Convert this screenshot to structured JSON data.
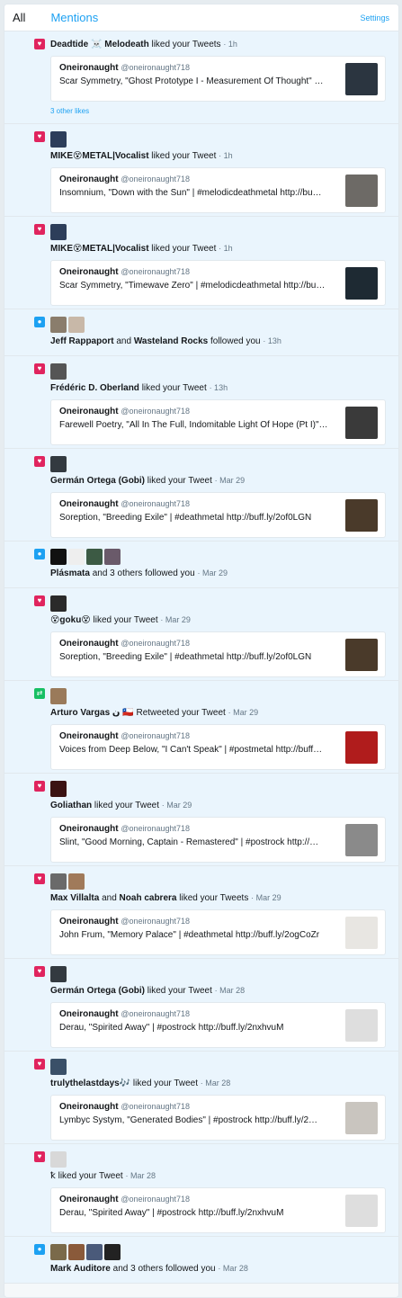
{
  "tabs": {
    "all": "All",
    "mentions": "Mentions",
    "settings": "Settings"
  },
  "colors": {
    "heart": "#e0245e",
    "follow": "#1da1f2",
    "retweet": "#17bf63",
    "link": "#1da1f2"
  },
  "items": [
    {
      "type": "heart",
      "icon": "heart-icon",
      "actor_html": "<b>Deadtide ☠️ Melodeath</b> liked your Tweets",
      "time": "1h",
      "avatars": [
        "#7a5c5a"
      ],
      "card": {
        "name": "Oneironaught",
        "handle": "@oneironaught718",
        "text": "Scar Symmetry, \"Ghost Prototype I - Measurement Of Thought\" …",
        "thumb": "#2b3540"
      },
      "more": "3 other likes"
    },
    {
      "type": "heart",
      "icon": "heart-icon",
      "actor_html": "<b>MIKE😵METAL|Vocalist</b> liked your Tweet",
      "time": "1h",
      "avatars": [
        "#2d3e5a"
      ],
      "card": {
        "name": "Oneironaught",
        "handle": "@oneironaught718",
        "text": "Insomnium, \"Down with the Sun\" | #melodicdeathmetal http://bu…",
        "thumb": "#6d6a66"
      }
    },
    {
      "type": "heart",
      "icon": "heart-icon",
      "actor_html": "<b>MIKE😵METAL|Vocalist</b> liked your Tweet",
      "time": "1h",
      "avatars": [
        "#2d3e5a"
      ],
      "card": {
        "name": "Oneironaught",
        "handle": "@oneironaught718",
        "text": "Scar Symmetry, \"Timewave Zero\" | #melodicdeathmetal http://bu…",
        "thumb": "#1e2a33"
      }
    },
    {
      "type": "follow",
      "icon": "person-icon",
      "actor_html": "<b>Jeff Rappaport</b> and <b>Wasteland Rocks</b> followed you",
      "time": "13h",
      "avatars": [
        "#8a7d6c",
        "#c8b8a8"
      ]
    },
    {
      "type": "heart",
      "icon": "heart-icon",
      "actor_html": "<b>Frédéric D. Oberland</b> liked your Tweet",
      "time": "13h",
      "avatars": [
        "#555555"
      ],
      "card": {
        "name": "Oneironaught",
        "handle": "@oneironaught718",
        "text": "Farewell Poetry, \"All In The Full, Indomitable Light Of Hope (Pt I)\"…",
        "thumb": "#3a3a3a"
      }
    },
    {
      "type": "heart",
      "icon": "heart-icon",
      "actor_html": "<b>Germán Ortega (Gobi)</b> liked your Tweet",
      "time": "Mar 29",
      "avatars": [
        "#333a40"
      ],
      "card": {
        "name": "Oneironaught",
        "handle": "@oneironaught718",
        "text": "Soreption, \"Breeding Exile\" | #deathmetal http://buff.ly/2of0LGN",
        "thumb": "#4a3a2a"
      }
    },
    {
      "type": "follow",
      "icon": "person-icon",
      "actor_html": "<b>Plásmata</b> and 3 others followed you",
      "time": "Mar 29",
      "avatars": [
        "#111111",
        "#eeeeee",
        "#3c5a44",
        "#6a5a6a"
      ]
    },
    {
      "type": "heart",
      "icon": "heart-icon",
      "actor_html": "<b>😵goku😵</b> liked your Tweet",
      "time": "Mar 29",
      "avatars": [
        "#2a2a2a"
      ],
      "card": {
        "name": "Oneironaught",
        "handle": "@oneironaught718",
        "text": "Soreption, \"Breeding Exile\" | #deathmetal http://buff.ly/2of0LGN",
        "thumb": "#4a3a2a"
      }
    },
    {
      "type": "retweet",
      "icon": "retweet-icon",
      "actor_html": "<b>Arturo Vargas ن 🇨🇱</b> Retweeted your Tweet",
      "time": "Mar 29",
      "avatars": [
        "#9a7a5a"
      ],
      "card": {
        "name": "Oneironaught",
        "handle": "@oneironaught718",
        "text": "Voices from Deep Below, \"I Can't Speak\" | #postmetal http://buff…",
        "thumb": "#b01c1c"
      }
    },
    {
      "type": "heart",
      "icon": "heart-icon",
      "actor_html": "<b>Goliathan</b> liked your Tweet",
      "time": "Mar 29",
      "avatars": [
        "#3a1212"
      ],
      "card": {
        "name": "Oneironaught",
        "handle": "@oneironaught718",
        "text": "Slint, \"Good Morning, Captain - Remastered\" | #postrock http://…",
        "thumb": "#8a8a8a"
      }
    },
    {
      "type": "heart",
      "icon": "heart-icon",
      "actor_html": "<b>Max Villalta</b> and <b>Noah cabrera</b> liked your Tweets",
      "time": "Mar 29",
      "avatars": [
        "#6a6a6a",
        "#a07a5a"
      ],
      "card": {
        "name": "Oneironaught",
        "handle": "@oneironaught718",
        "text": "John Frum, \"Memory Palace\" | #deathmetal http://buff.ly/2ogCoZr",
        "thumb": "#e8e6e2"
      }
    },
    {
      "type": "heart",
      "icon": "heart-icon",
      "actor_html": "<b>Germán Ortega (Gobi)</b> liked your Tweet",
      "time": "Mar 28",
      "avatars": [
        "#333a40"
      ],
      "card": {
        "name": "Oneironaught",
        "handle": "@oneironaught718",
        "text": "Derau, \"Spirited Away\" | #postrock http://buff.ly/2nxhvuM",
        "thumb": "#dedede"
      }
    },
    {
      "type": "heart",
      "icon": "heart-icon",
      "actor_html": "<b>trulythelastdays🎶</b> liked your Tweet",
      "time": "Mar 28",
      "avatars": [
        "#3a5068"
      ],
      "card": {
        "name": "Oneironaught",
        "handle": "@oneironaught718",
        "text": "Lymbyc Systym, \"Generated Bodies\" | #postrock http://buff.ly/2…",
        "thumb": "#c9c5bf"
      }
    },
    {
      "type": "heart",
      "icon": "heart-icon",
      "actor_html": "ꝁ liked your Tweet",
      "time": "Mar 28",
      "avatars": [
        "#d8d8d8"
      ],
      "card": {
        "name": "Oneironaught",
        "handle": "@oneironaught718",
        "text": "Derau, \"Spirited Away\" | #postrock http://buff.ly/2nxhvuM",
        "thumb": "#dedede"
      }
    },
    {
      "type": "follow",
      "icon": "person-icon",
      "actor_html": "<b>Mark Auditore</b> and 3 others followed you",
      "time": "Mar 28",
      "avatars": [
        "#7a6a4a",
        "#8a5a3a",
        "#4a5a7a",
        "#222222"
      ]
    }
  ]
}
